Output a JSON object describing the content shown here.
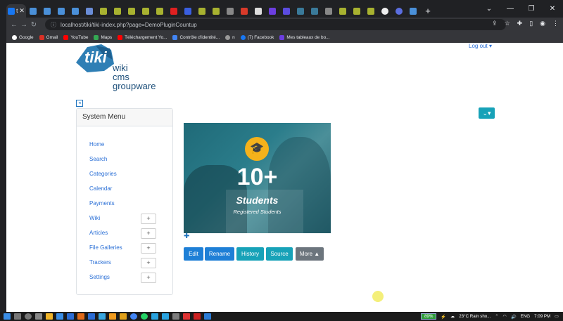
{
  "browser": {
    "active_tab_label": "t",
    "url": "localhost/tiki/tiki-index.php?page=DemoPluginCountup",
    "bookmarks": [
      "Google",
      "Gmail",
      "YouTube",
      "Maps",
      "Téléchargement Yo...",
      "Contrôle d'identité...",
      "n",
      "(7) Facebook",
      "Mes tableaux de bo..."
    ]
  },
  "header": {
    "logo_text": "tiki",
    "logo_lines": [
      "wiki",
      "cms",
      "groupware"
    ],
    "logout_label": "Log out"
  },
  "system_menu": {
    "title": "System Menu",
    "items": [
      {
        "label": "Home",
        "expandable": false
      },
      {
        "label": "Search",
        "expandable": false
      },
      {
        "label": "Categories",
        "expandable": false
      },
      {
        "label": "Calendar",
        "expandable": false
      },
      {
        "label": "Payments",
        "expandable": false
      },
      {
        "label": "Wiki",
        "expandable": true
      },
      {
        "label": "Articles",
        "expandable": true
      },
      {
        "label": "File Galleries",
        "expandable": true
      },
      {
        "label": "Trackers",
        "expandable": true
      },
      {
        "label": "Settings",
        "expandable": true
      }
    ],
    "plus_symbol": "+"
  },
  "countup": {
    "count": "10+",
    "label": "Students",
    "sublabel": "Registered Students"
  },
  "actions": [
    {
      "label": "Edit",
      "color": "#1e7fd6"
    },
    {
      "label": "Rename",
      "color": "#1e7fd6"
    },
    {
      "label": "History",
      "color": "#17a2b8"
    },
    {
      "label": "Source",
      "color": "#17a2b8"
    },
    {
      "label": "More ▲",
      "color": "#6c757d"
    }
  ],
  "taskbar": {
    "battery": "89%",
    "weather": "23°C  Rain sho...",
    "lang": "ENG",
    "time": "7:09 PM"
  }
}
